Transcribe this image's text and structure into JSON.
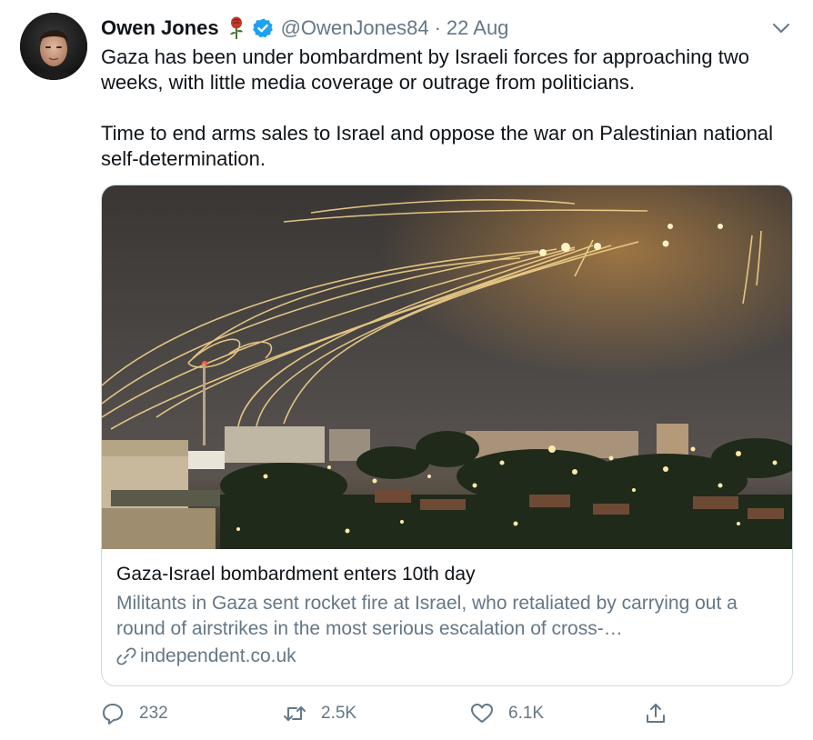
{
  "tweet": {
    "author": {
      "display_name": "Owen Jones",
      "handle": "@OwenJones84",
      "verified": true,
      "emoji_icon": "rose-icon"
    },
    "separator": "·",
    "date": "22 Aug",
    "text_paragraphs": [
      "Gaza has been under bombardment by Israeli forces for approaching two weeks, with little media coverage or outrage from politicians.",
      "Time to end arms sales to Israel and oppose the war on Palestinian national self-determination."
    ]
  },
  "card": {
    "image_icon": "photo-night-sky-interceptors",
    "title": "Gaza-Israel bombardment enters 10th day",
    "description": "Militants in Gaza sent rocket fire at Israel, who retaliated by carrying out a round of airstrikes in the most serious escalation of cross-…",
    "source": "independent.co.uk"
  },
  "actions": {
    "reply_count": "232",
    "retweet_count": "2.5K",
    "like_count": "6.1K"
  },
  "colors": {
    "text": "#0f1419",
    "secondary": "#657786",
    "verified": "#1da1f2",
    "border": "#cfd9de",
    "rose": "#c0392b"
  }
}
